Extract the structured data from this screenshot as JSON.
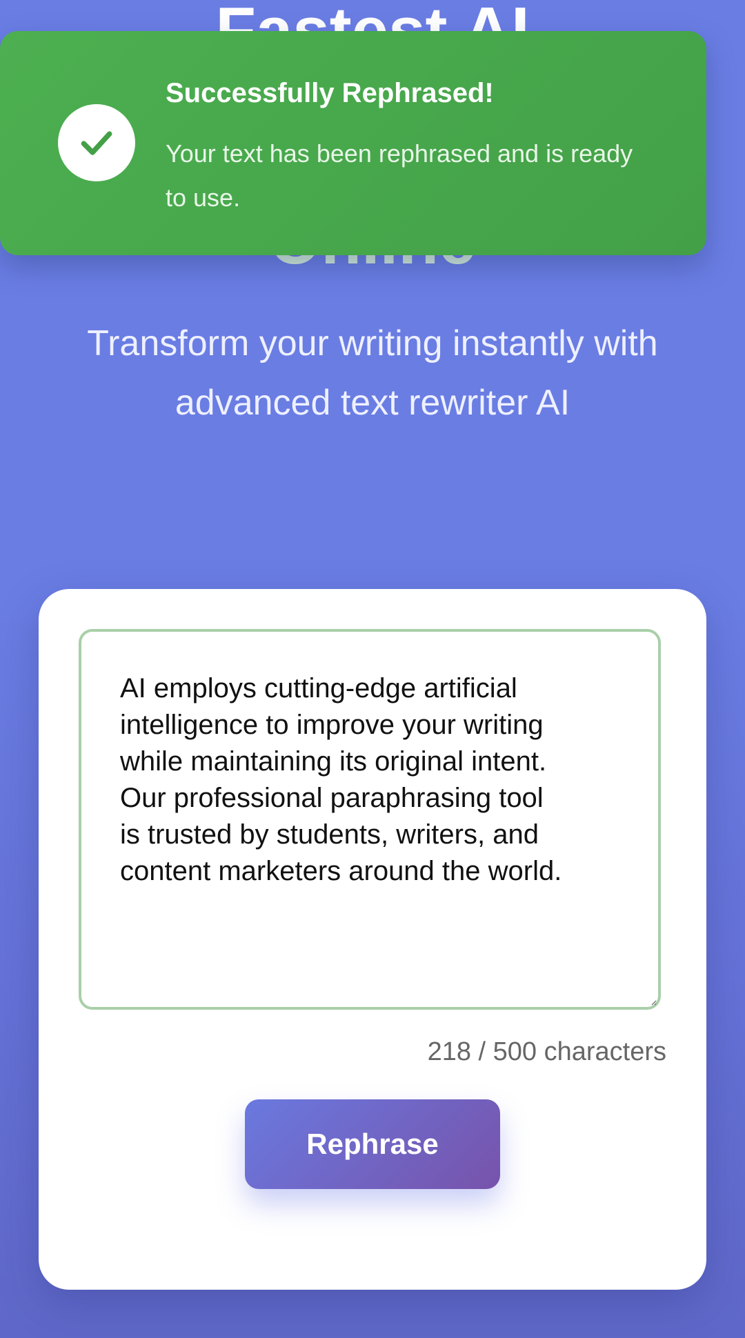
{
  "hero": {
    "title_top": "Fastest AI",
    "title_bottom": "Online",
    "subtitle": "Transform your writing instantly with advanced text rewriter AI"
  },
  "toast": {
    "icon": "check-icon",
    "title": "Successfully Rephrased!",
    "message": "Your text has been rephrased and is ready to use.",
    "color": "#4caf50"
  },
  "editor": {
    "text": "AI employs cutting-edge artificial\nintelligence to improve your writing\nwhile maintaining its original intent.\nOur professional paraphrasing tool\nis trusted by students, writers, and\ncontent marketers around the world.",
    "char_count": "218 / 500 characters",
    "border_color": "#a9cfa9"
  },
  "actions": {
    "rephrase_label": "Rephrase"
  },
  "colors": {
    "background": "#6a7de3",
    "button_start": "#6a79df",
    "button_end": "#7753ab"
  }
}
